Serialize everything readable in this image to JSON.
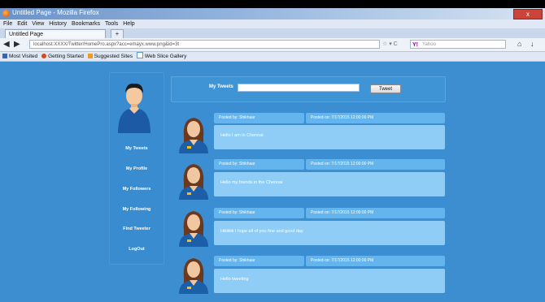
{
  "window": {
    "title": "Untitled Page - Mozilla Firefox",
    "close_label": "x"
  },
  "menu": [
    "File",
    "Edit",
    "View",
    "History",
    "Bookmarks",
    "Tools",
    "Help"
  ],
  "tab": {
    "label": "Untitled Page",
    "new_tab": "+"
  },
  "toolbar": {
    "back": "◀",
    "forward": "▶",
    "url": "localhost:XXXX/Twitter/HomePro.aspx?acc=emayx.www.png&id=3t",
    "url_icons": "☆ ▾ C",
    "search_placeholder": "Yahoo",
    "search_engine": "Y!",
    "home": "⌂",
    "download": "↓"
  },
  "bookmarks": [
    {
      "label": "Most Visited",
      "icon_color": "#3b63b4"
    },
    {
      "label": "Getting Started",
      "icon_color": "#d84a14"
    },
    {
      "label": "Suggested Sites",
      "icon_color": "#f29a1c"
    },
    {
      "label": "Web Slice Gallery",
      "icon_color": "#5b9bd5"
    }
  ],
  "sidebar": {
    "items": [
      "My Tweets",
      "My Profile",
      "My Followers",
      "My Following",
      "Find Tweeter",
      "LogOut"
    ]
  },
  "compose": {
    "label": "My Tweets",
    "input_value": "",
    "button": "Tweet"
  },
  "posts": [
    {
      "by": "Posted by: Shikhaar",
      "on": "Posted on: 7/17/2015 12:00:00 PM",
      "text": "Hello I am in Chennai"
    },
    {
      "by": "Posted by: Shikhaar",
      "on": "Posted on: 7/17/2015 12:00:00 PM",
      "text": "Hello my friends in the Chennai"
    },
    {
      "by": "Posted by: Shikhaar",
      "on": "Posted on: 7/17/2015 12:00:00 PM",
      "text": "Hiiiiiiiiii  I hope all of you fine and good day"
    },
    {
      "by": "Posted by: Shikhaar",
      "on": "Posted on: 7/17/2015 12:00:00 PM",
      "text": "Hello tweeting"
    }
  ],
  "colors": {
    "page_bg": "#3d8ed0",
    "header_cell": "#64b5ee",
    "body_cell": "#8fcdf6"
  }
}
